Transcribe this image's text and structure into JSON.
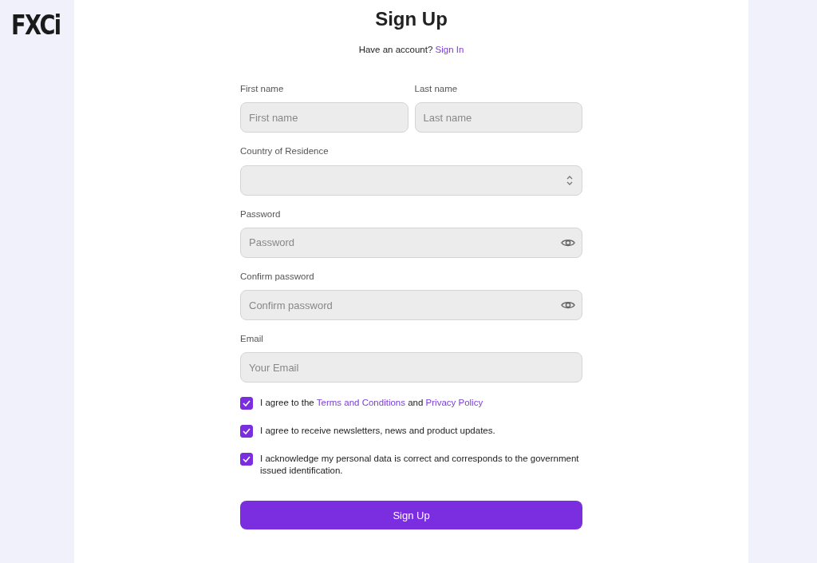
{
  "logo": {
    "text": "FXCi"
  },
  "title": "Sign Up",
  "signin": {
    "prompt": "Have an account?",
    "link": "Sign In"
  },
  "name_fields": [
    {
      "label": "First name",
      "placeholder": "First name"
    },
    {
      "label": "Last name",
      "placeholder": "Last name"
    }
  ],
  "fields": [
    {
      "kind": "select",
      "label": "Country of Residence"
    },
    {
      "kind": "password",
      "label": "Password",
      "placeholder": "Password"
    },
    {
      "kind": "password",
      "label": "Confirm password",
      "placeholder": "Confirm password"
    },
    {
      "kind": "text",
      "label": "Email",
      "placeholder": "Your Email"
    }
  ],
  "agreements": [
    {
      "checked": true,
      "parts": [
        {
          "kind": "text",
          "text": "I agree to the "
        },
        {
          "kind": "link",
          "text": "Terms and Conditions"
        },
        {
          "kind": "text",
          "text": " and "
        },
        {
          "kind": "link",
          "text": "Privacy Policy"
        }
      ]
    },
    {
      "checked": true,
      "parts": [
        {
          "kind": "text",
          "text": "I agree to receive newsletters, news and product updates."
        }
      ]
    },
    {
      "checked": true,
      "parts": [
        {
          "kind": "text",
          "text": "I acknowledge my personal data is correct and corresponds to the government issued identification."
        }
      ]
    }
  ],
  "submit": "Sign Up"
}
